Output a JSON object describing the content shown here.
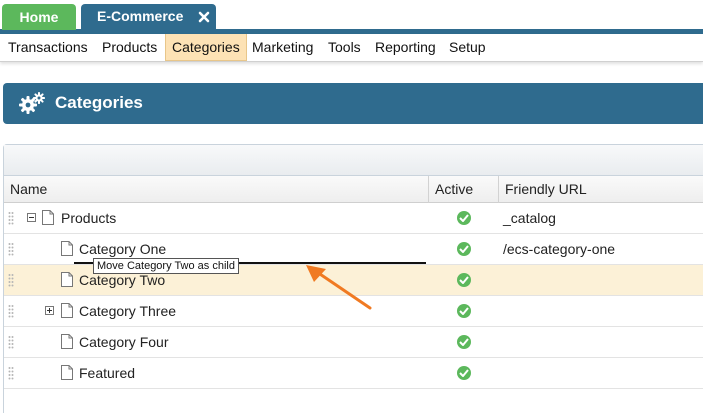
{
  "tabs": [
    {
      "label": "Home",
      "color": "#5cb85c"
    },
    {
      "label": "E-Commerce",
      "color": "#2f6b8e",
      "closable": true
    }
  ],
  "menu": {
    "items": [
      "Transactions",
      "Products",
      "Categories",
      "Marketing",
      "Tools",
      "Reporting",
      "Setup"
    ],
    "active": "Categories"
  },
  "page": {
    "title": "Categories",
    "icon": "gears-icon"
  },
  "grid": {
    "columns": [
      "Name",
      "Active",
      "Friendly URL"
    ],
    "rows": [
      {
        "name": "Products",
        "active": true,
        "url": "_catalog",
        "expander": "minus"
      },
      {
        "name": "Category One",
        "active": true,
        "url": "/ecs-category-one",
        "expander": ""
      },
      {
        "name": "Category Two",
        "active": true,
        "url": "",
        "expander": "",
        "highlighted": true
      },
      {
        "name": "Category Three",
        "active": true,
        "url": "",
        "expander": "plus"
      },
      {
        "name": "Category Four",
        "active": true,
        "url": "",
        "expander": ""
      },
      {
        "name": "Featured",
        "active": true,
        "url": "",
        "expander": ""
      }
    ]
  },
  "drag": {
    "tooltip": "Move Category Two as child",
    "arrow_color": "#f07a22"
  }
}
